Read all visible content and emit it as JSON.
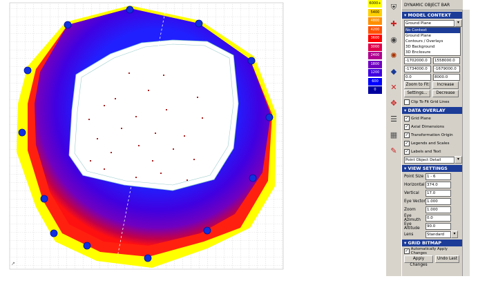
{
  "legend": {
    "items": [
      {
        "label": "6000+",
        "color": "#ffff00"
      },
      {
        "label": "5400",
        "color": "#ffd000"
      },
      {
        "label": "4800",
        "color": "#ff9000"
      },
      {
        "label": "4200",
        "color": "#ff5000"
      },
      {
        "label": "3600",
        "color": "#ff0000"
      },
      {
        "label": "3000",
        "color": "#e0004c"
      },
      {
        "label": "2400",
        "color": "#b00090"
      },
      {
        "label": "1800",
        "color": "#7000c0"
      },
      {
        "label": "1200",
        "color": "#4000e0"
      },
      {
        "label": "600",
        "color": "#0000ff"
      },
      {
        "label": "0",
        "color": "#0000a0"
      }
    ]
  },
  "toolbar": {
    "tools": [
      {
        "name": "shield-icon",
        "glyph": "⛨",
        "color": "#333333"
      },
      {
        "name": "pushpin-icon",
        "glyph": "✚",
        "color": "#cc2222"
      },
      {
        "name": "eye-icon",
        "glyph": "◉",
        "color": "#444444"
      },
      {
        "name": "gear-icon",
        "glyph": "✺",
        "color": "#aa3300"
      },
      {
        "name": "cube-icon",
        "glyph": "◆",
        "color": "#1c3c98"
      },
      {
        "name": "axis-icon",
        "glyph": "✕",
        "color": "#cc2222"
      },
      {
        "name": "spread-icon",
        "glyph": "✥",
        "color": "#cc2222"
      },
      {
        "name": "stack-icon",
        "glyph": "☰",
        "color": "#333333"
      },
      {
        "name": "building-icon",
        "glyph": "▦",
        "color": "#555555"
      },
      {
        "name": "pencil-icon",
        "glyph": "✎",
        "color": "#cc2222"
      }
    ]
  },
  "panel": {
    "title": "DYNAMIC OBJECT BAR",
    "model_context": {
      "header": "MODEL CONTEXT",
      "selected": "Ground Plane",
      "options": [
        "No Context",
        "Ground Plane",
        "Contours / Overlays",
        "3D Background",
        "3D Enclosure"
      ],
      "extent_x": [
        "-1702000.0",
        "1558000.0"
      ],
      "extent_y": [
        "-1734000.0",
        "-1679000.0"
      ],
      "extent_z": [
        "0.0",
        "8000.0"
      ],
      "zoom_button": "Zoom to Fit",
      "increase_button": "Increase",
      "settings_button": "Settings...",
      "decrease_button": "Decrease",
      "clip_label": "Clip To Fit Grid Lines"
    },
    "data_overlay": {
      "header": "DATA OVERLAY",
      "options": [
        {
          "label": "Grid Plane",
          "checked": true
        },
        {
          "label": "Axial Dimensions",
          "checked": true
        },
        {
          "label": "Transformation Origin",
          "checked": true
        },
        {
          "label": "Legends and Scales",
          "checked": true
        },
        {
          "label": "Labels and Text",
          "checked": true
        }
      ],
      "point_select": "Point Object Detail"
    },
    "view_settings": {
      "header": "VIEW SETTINGS",
      "point_size_label": "Point Size",
      "point_size": "1 - 6",
      "horizontal_label": "Horizontal",
      "horizontal": "374.0",
      "vertical_label": "Vertical",
      "vertical": "17.0",
      "eye_x_label": "Eye Vector",
      "eye_x": "1.000",
      "zoom_label": "Zoom",
      "zoom": "1.000",
      "eye_azimuth_label": "Eye Azimuth",
      "eye_azimuth": "0.0",
      "eye_altitude_label": "Eye Altitude",
      "eye_altitude": "90.0",
      "lens_label": "Lens",
      "lens": "Standard"
    },
    "grid_bitmap": {
      "header": "GRID BITMAP",
      "auto_label": "Automatically Apply Changes",
      "apply_button": "Apply Changes",
      "undo_button": "Undo Last"
    }
  }
}
